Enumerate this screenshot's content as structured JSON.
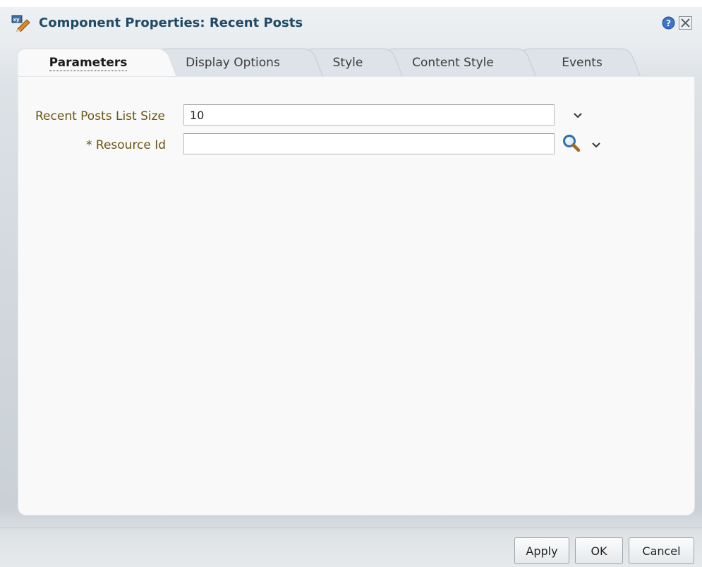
{
  "dialog": {
    "title": "Component Properties: Recent Posts",
    "icon": "edit-properties-icon",
    "help_icon": "help-icon",
    "close_icon": "close-icon"
  },
  "tabs": [
    {
      "label": "Parameters",
      "active": true
    },
    {
      "label": "Display Options",
      "active": false
    },
    {
      "label": "Style",
      "active": false
    },
    {
      "label": "Content Style",
      "active": false
    },
    {
      "label": "Events",
      "active": false
    }
  ],
  "fields": {
    "list_size": {
      "label": "Recent Posts List Size",
      "value": "10"
    },
    "resource_id": {
      "label": "* Resource Id",
      "value": ""
    }
  },
  "buttons": {
    "apply": "Apply",
    "ok": "OK",
    "cancel": "Cancel"
  },
  "colors": {
    "title": "#1f4a66",
    "label": "#6b5414",
    "panel": "#f8f9f8"
  }
}
